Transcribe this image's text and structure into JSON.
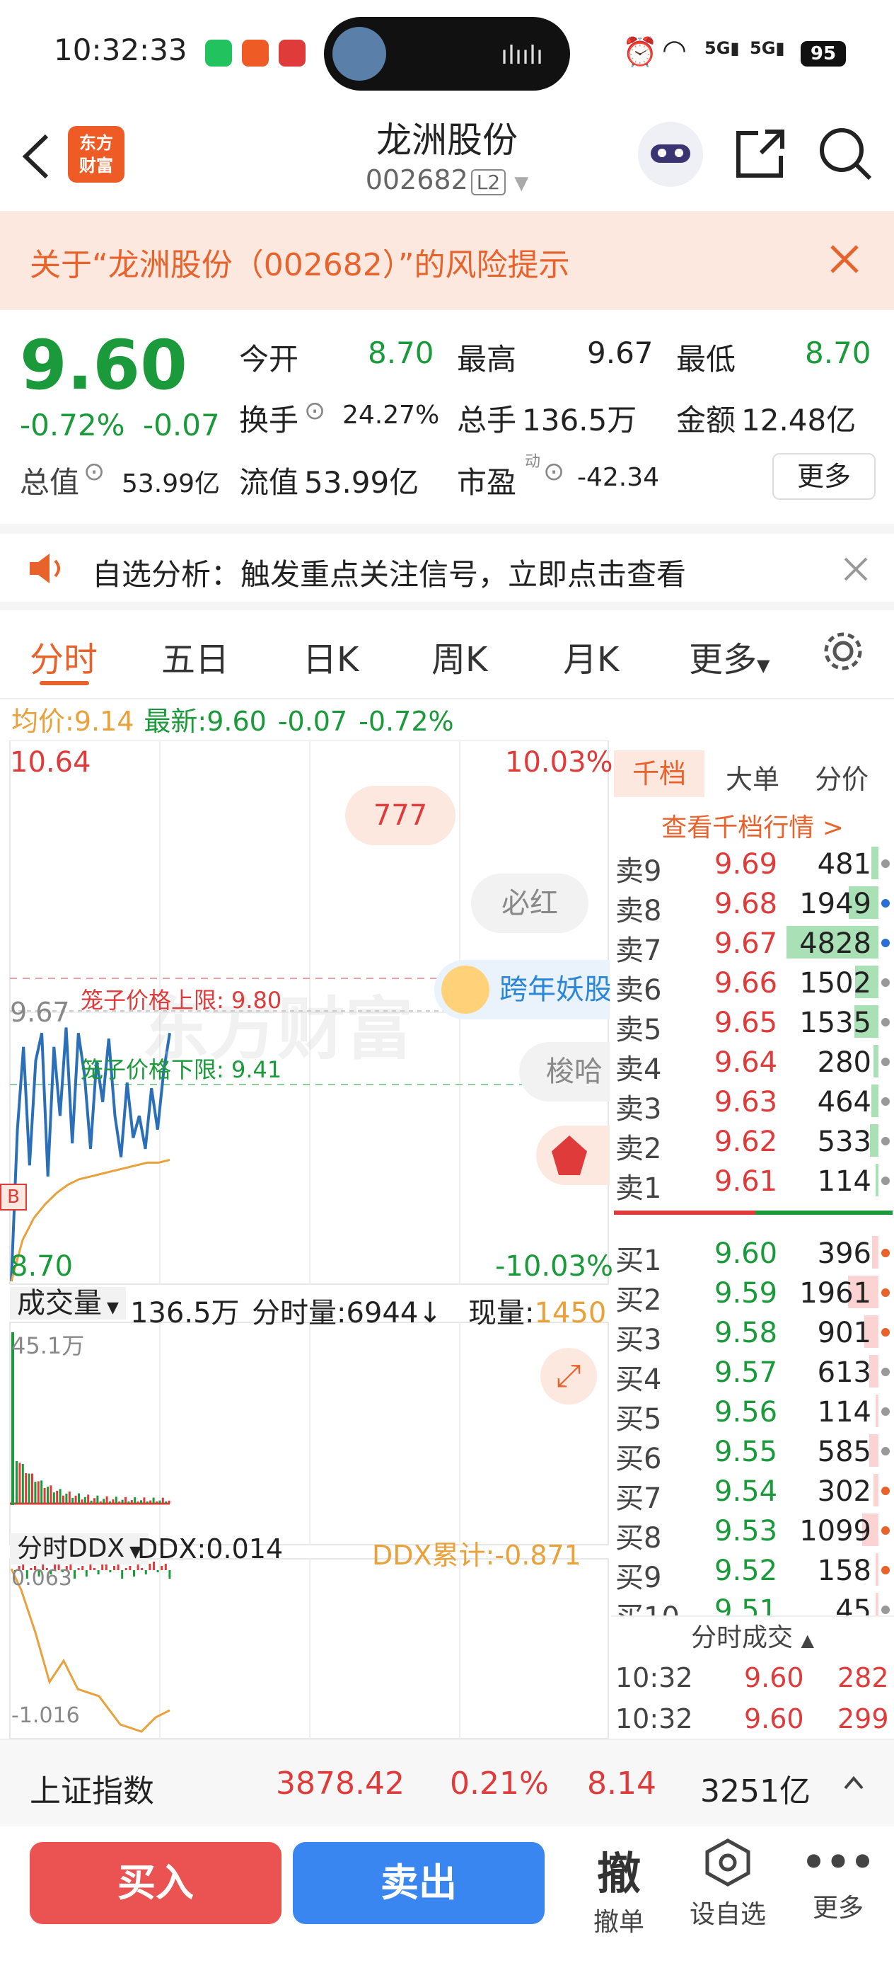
{
  "status": {
    "time": "10:32:33",
    "battery": "95",
    "net1": "5G",
    "net2": "5G"
  },
  "header": {
    "logo_line1": "东方",
    "logo_line2": "财富",
    "title": "龙洲股份",
    "code": "002682",
    "level": "L2"
  },
  "risk_banner": {
    "text": "关于“龙洲股份（002682）”的风险提示"
  },
  "quote": {
    "price": "9.60",
    "change_pct": "-0.72%",
    "change": "-0.07",
    "open_label": "今开",
    "open": "8.70",
    "high_label": "最高",
    "high": "9.67",
    "low_label": "最低",
    "low": "8.70",
    "turnover_label": "换手",
    "turnover": "24.27%",
    "volume_label": "总手",
    "volume": "136.5万",
    "amount_label": "金额",
    "amount": "12.48亿",
    "mktcap_label": "总值",
    "mktcap": "53.99亿",
    "float_label": "流值",
    "float": "53.99亿",
    "pe_label": "市盈",
    "pe_sup": "动",
    "pe": "-42.34",
    "more": "更多"
  },
  "notice": {
    "text": "自选分析：触发重点关注信号，立即点击查看"
  },
  "tabs": [
    "分时",
    "五日",
    "日K",
    "周K",
    "月K",
    "更多"
  ],
  "info_line": {
    "avg_label": "均价:",
    "avg": "9.14",
    "latest_label": "最新:",
    "latest": "9.60",
    "chg": "-0.07",
    "pct": "-0.72%"
  },
  "chart": {
    "y_top": "10.64",
    "y_top_pct": "10.03%",
    "y_bottom": "8.70",
    "y_bottom_pct": "-10.03%",
    "y_mark": "9.67",
    "b_marker": "B",
    "upper_limit": "笼子价格上限: 9.80",
    "lower_limit": "笼子价格下限: 9.41",
    "watermark": "东方财富",
    "float_777": "777",
    "float_bihong": "必红",
    "float_kuanian": "跨年妖股",
    "float_suoha": "梭哈",
    "vol_label": "成交量",
    "vol_total": "136.5万",
    "vol_tick_label": "分时量:",
    "vol_tick": "6944",
    "vol_now_label": "现量:",
    "vol_now": "1450",
    "vol_max": "45.1万",
    "ddx_label": "分时DDX",
    "ddx": "DDX:0.014",
    "ddx_cum": "DDX累计:-0.871",
    "ddx_top": "0.063",
    "ddx_bottom": "-1.016"
  },
  "chart_data": {
    "type": "line",
    "series": [
      {
        "values": [
          8.7,
          9.25,
          9.55,
          9.12,
          9.5,
          9.6,
          9.08,
          9.55,
          9.3,
          9.62,
          9.2,
          9.6,
          9.45,
          9.18,
          9.5,
          9.35,
          9.58,
          9.3,
          9.15,
          9.42,
          9.22,
          9.3,
          9.18,
          9.4,
          9.25,
          9.46,
          9.6
        ]
      },
      {
        "values": [
          8.7,
          8.85,
          8.93,
          8.98,
          9.02,
          9.05,
          9.07,
          9.08,
          9.09,
          9.1,
          9.11,
          9.12,
          9.13,
          9.13,
          9.14
        ]
      }
    ],
    "ylim": [
      8.7,
      10.64
    ]
  },
  "book": {
    "tabs": [
      "千档",
      "大单",
      "分价"
    ],
    "link": "查看千档行情 >",
    "asks": [
      {
        "name": "卖9",
        "price": "9.69",
        "vol": "481",
        "bar": 0.08,
        "dot": "#999"
      },
      {
        "name": "卖8",
        "price": "9.68",
        "vol": "1949",
        "bar": 0.32,
        "dot": "#2a6fd6"
      },
      {
        "name": "卖7",
        "price": "9.67",
        "vol": "4828",
        "bar": 1.0,
        "dot": "#2a6fd6"
      },
      {
        "name": "卖6",
        "price": "9.66",
        "vol": "1502",
        "bar": 0.25,
        "dot": "#999"
      },
      {
        "name": "卖5",
        "price": "9.65",
        "vol": "1535",
        "bar": 0.26,
        "dot": "#999"
      },
      {
        "name": "卖4",
        "price": "9.64",
        "vol": "280",
        "bar": 0.05,
        "dot": "#999"
      },
      {
        "name": "卖3",
        "price": "9.63",
        "vol": "464",
        "bar": 0.08,
        "dot": "#999"
      },
      {
        "name": "卖2",
        "price": "9.62",
        "vol": "533",
        "bar": 0.09,
        "dot": "#999"
      },
      {
        "name": "卖1",
        "price": "9.61",
        "vol": "114",
        "bar": 0.03,
        "dot": "#999"
      }
    ],
    "bids": [
      {
        "name": "买1",
        "price": "9.60",
        "vol": "396",
        "bar": 0.07,
        "dot": "#e8622c"
      },
      {
        "name": "买2",
        "price": "9.59",
        "vol": "1961",
        "bar": 0.33,
        "dot": "#e8622c"
      },
      {
        "name": "买3",
        "price": "9.58",
        "vol": "901",
        "bar": 0.15,
        "dot": "#e8622c"
      },
      {
        "name": "买4",
        "price": "9.57",
        "vol": "613",
        "bar": 0.1,
        "dot": "#999"
      },
      {
        "name": "买5",
        "price": "9.56",
        "vol": "114",
        "bar": 0.03,
        "dot": "#999"
      },
      {
        "name": "买6",
        "price": "9.55",
        "vol": "585",
        "bar": 0.1,
        "dot": "#999"
      },
      {
        "name": "买7",
        "price": "9.54",
        "vol": "302",
        "bar": 0.05,
        "dot": "#e8622c"
      },
      {
        "name": "买8",
        "price": "9.53",
        "vol": "1099",
        "bar": 0.18,
        "dot": "#e8622c"
      },
      {
        "name": "买9",
        "price": "9.52",
        "vol": "158",
        "bar": 0.03,
        "dot": "#e8622c"
      },
      {
        "name": "买10",
        "price": "9.51",
        "vol": "45",
        "bar": 0.01,
        "dot": "#999"
      }
    ],
    "trades_title": "分时成交",
    "trades": [
      {
        "time": "10:32",
        "price": "9.60",
        "vol": "282"
      },
      {
        "time": "10:32",
        "price": "9.60",
        "vol": "299"
      }
    ]
  },
  "index_bar": {
    "name": "上证指数",
    "value": "3878.42",
    "pct": "0.21%",
    "chg": "8.14",
    "amount": "3251亿"
  },
  "bottom": {
    "buy": "买入",
    "sell": "卖出",
    "cancel_glyph": "撤",
    "cancel": "撤单",
    "watch": "设自选",
    "more": "更多"
  }
}
